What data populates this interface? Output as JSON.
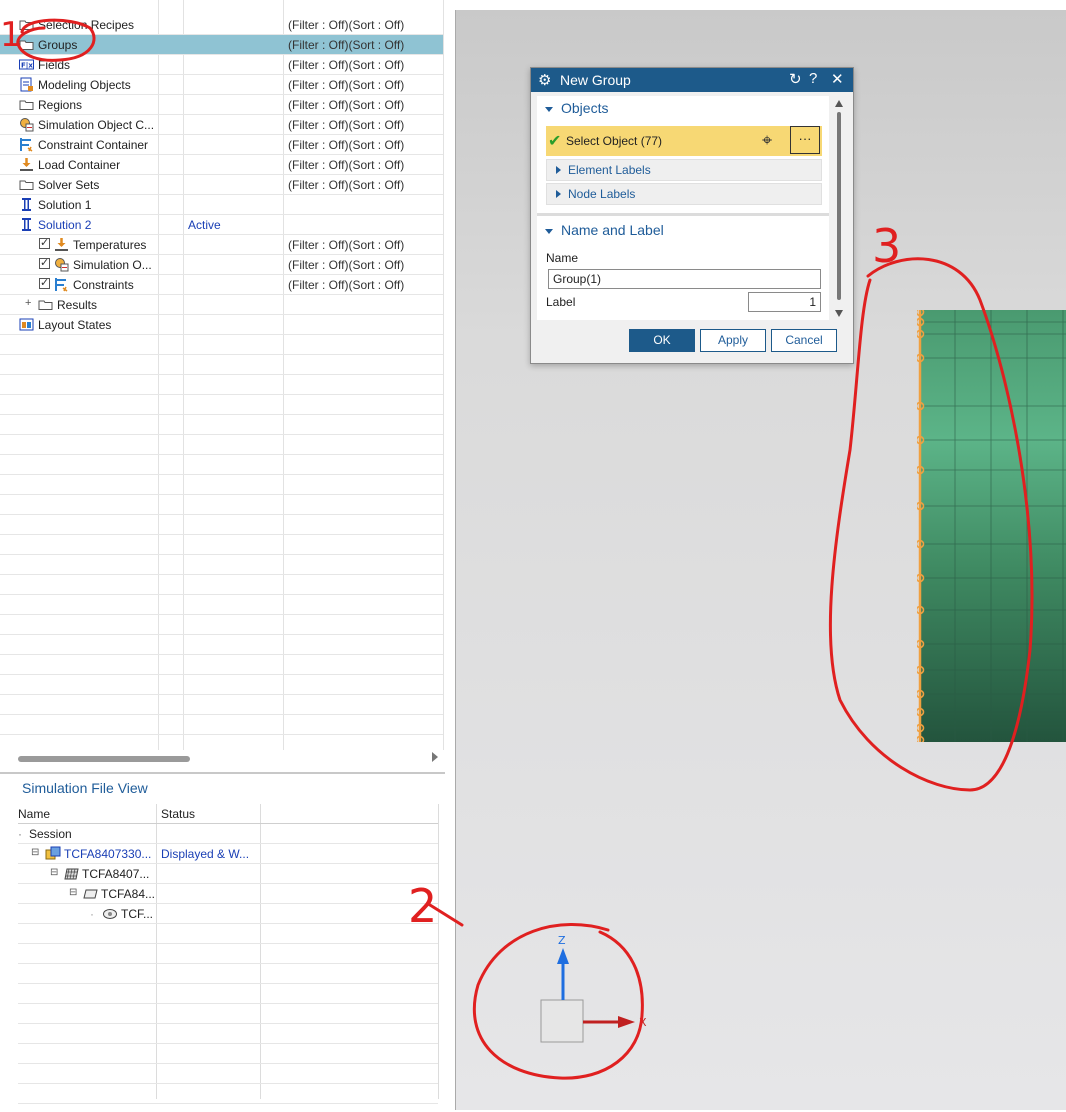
{
  "navigator": {
    "rows": [
      {
        "name": "Selection Recipes",
        "state": "",
        "filter": "(Filter : Off)(Sort : Off)"
      },
      {
        "name": "Groups",
        "state": "",
        "filter": "(Filter : Off)(Sort : Off)"
      },
      {
        "name": "Fields",
        "state": "",
        "filter": "(Filter : Off)(Sort : Off)"
      },
      {
        "name": "Modeling Objects",
        "state": "",
        "filter": "(Filter : Off)(Sort : Off)"
      },
      {
        "name": "Regions",
        "state": "",
        "filter": "(Filter : Off)(Sort : Off)"
      },
      {
        "name": "Simulation Object C...",
        "state": "",
        "filter": "(Filter : Off)(Sort : Off)"
      },
      {
        "name": "Constraint Container",
        "state": "",
        "filter": "(Filter : Off)(Sort : Off)"
      },
      {
        "name": "Load Container",
        "state": "",
        "filter": "(Filter : Off)(Sort : Off)"
      },
      {
        "name": "Solver Sets",
        "state": "",
        "filter": "(Filter : Off)(Sort : Off)"
      },
      {
        "name": "Solution 1",
        "state": "",
        "filter": ""
      },
      {
        "name": "Solution 2",
        "state": "Active",
        "filter": ""
      },
      {
        "name": "Temperatures",
        "state": "",
        "filter": "(Filter : Off)(Sort : Off)"
      },
      {
        "name": "Simulation O...",
        "state": "",
        "filter": "(Filter : Off)(Sort : Off)"
      },
      {
        "name": "Constraints",
        "state": "",
        "filter": "(Filter : Off)(Sort : Off)"
      },
      {
        "name": "Results",
        "state": "",
        "filter": ""
      },
      {
        "name": "Layout States",
        "state": "",
        "filter": ""
      }
    ]
  },
  "sim_file_view": {
    "title": "Simulation File View",
    "columns": {
      "name": "Name",
      "status": "Status"
    },
    "rows": [
      {
        "name": "Session",
        "status": ""
      },
      {
        "name": "TCFA8407330...",
        "status": "Displayed & W..."
      },
      {
        "name": "TCFA8407...",
        "status": ""
      },
      {
        "name": "TCFA84...",
        "status": ""
      },
      {
        "name": "TCF...",
        "status": ""
      }
    ]
  },
  "dialog": {
    "title": "New Group",
    "objects_header": "Objects",
    "select_object": "Select Object (77)",
    "more_label": "···",
    "element_labels": "Element Labels",
    "node_labels": "Node Labels",
    "name_label_header": "Name and Label",
    "name_label": "Name",
    "name_value": "Group(1)",
    "label_label": "Label",
    "label_value": "1",
    "ok": "OK",
    "apply": "Apply",
    "cancel": "Cancel",
    "reset_icon": "↻",
    "help_icon": "?",
    "close_icon": "✕"
  },
  "triad": {
    "z_label": "Z",
    "x_label": "X"
  },
  "annotations": {
    "one": "1",
    "two": "2",
    "three": "3"
  },
  "colors": {
    "accent": "#1d5a8a",
    "selection": "#8fc3d3",
    "highlight": "#f7d874",
    "mesh": "#4f9e74",
    "node": "#f0a040",
    "annotation": "#e02020"
  }
}
